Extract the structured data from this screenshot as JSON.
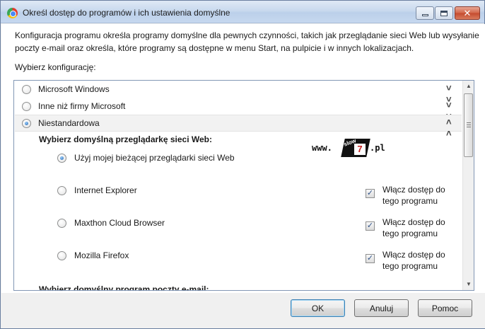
{
  "window": {
    "title": "Określ dostęp do programów i ich ustawienia domyślne",
    "app_icon": "set-program-access-icon"
  },
  "description": "Konfiguracja programu określa programy domyślne dla pewnych czynności, takich jak przeglądanie sieci Web lub wysyłanie poczty e-mail oraz określa, które programy są dostępne w menu Start, na pulpicie i w innych lokalizacjach.",
  "choose_label": "Wybierz konfigurację:",
  "configurations": [
    {
      "label": "Microsoft Windows",
      "selected": false,
      "expanded": false
    },
    {
      "label": "Inne niż firmy Microsoft",
      "selected": false,
      "expanded": false
    },
    {
      "label": "Niestandardowa",
      "selected": true,
      "expanded": true
    }
  ],
  "browser_section": {
    "heading": "Wybierz domyślną przeglądarkę sieci Web:",
    "options": [
      {
        "label": "Użyj mojej bieżącej przeglądarki sieci Web",
        "selected": true
      },
      {
        "label": "Internet Explorer",
        "selected": false,
        "access_checked": true
      },
      {
        "label": "Maxthon Cloud Browser",
        "selected": false,
        "access_checked": true
      },
      {
        "label": "Mozilla Firefox",
        "selected": false,
        "access_checked": true
      }
    ],
    "access_label": "Włącz dostęp do tego programu"
  },
  "email_section": {
    "heading": "Wybierz domyślny program poczty e-mail:"
  },
  "watermark": {
    "www": "www.",
    "badge_text": "slow",
    "badge_number": "7",
    "tld": ".pl"
  },
  "buttons": {
    "ok": "OK",
    "cancel": "Anuluj",
    "help": "Pomoc"
  },
  "colors": {
    "titlebar": "#c9d9ee",
    "close_button": "#c44a2e",
    "selection_row": "#f2f2f2",
    "radio_dot": "#1f5fa8"
  }
}
